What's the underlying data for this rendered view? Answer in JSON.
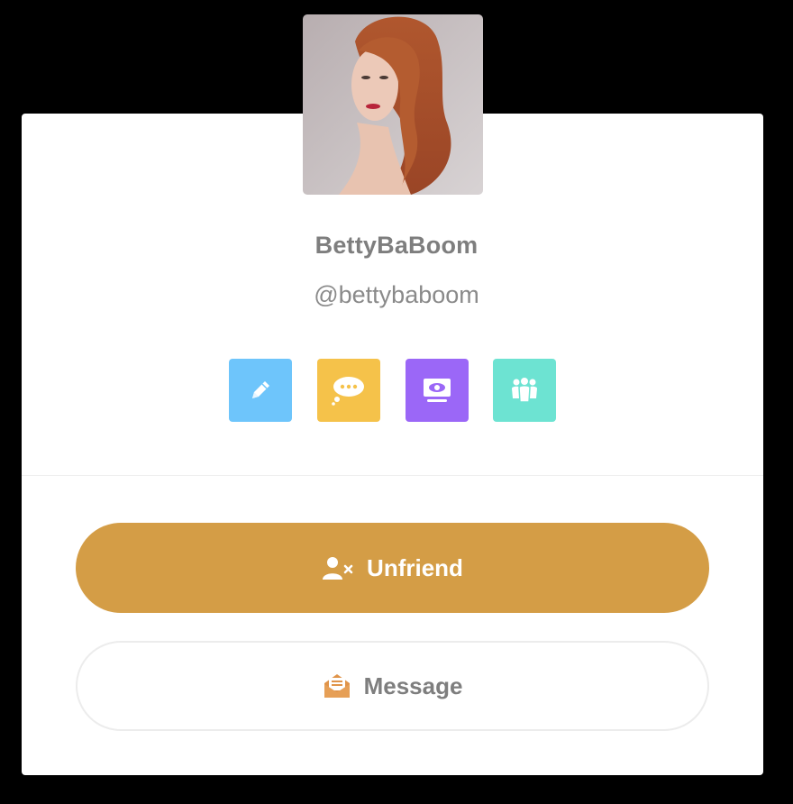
{
  "profile": {
    "username": "BettyBaBoom",
    "handle": "@bettybaboom",
    "avatar_alt": "Profile photo of a woman with long red wavy hair"
  },
  "actions": [
    {
      "name": "edit",
      "icon": "pencil-icon",
      "color": "#6ec5fb"
    },
    {
      "name": "chat",
      "icon": "chat-bubble-icon",
      "color": "#f5c24a"
    },
    {
      "name": "watch",
      "icon": "monitor-eye-icon",
      "color": "#9b67f7"
    },
    {
      "name": "groups",
      "icon": "group-icon",
      "color": "#6de3d2"
    }
  ],
  "buttons": {
    "unfriend_label": "Unfriend",
    "message_label": "Message"
  },
  "colors": {
    "accent": "#d49d46",
    "text_muted": "#7e7e7e",
    "background": "#000000",
    "card": "#ffffff"
  }
}
